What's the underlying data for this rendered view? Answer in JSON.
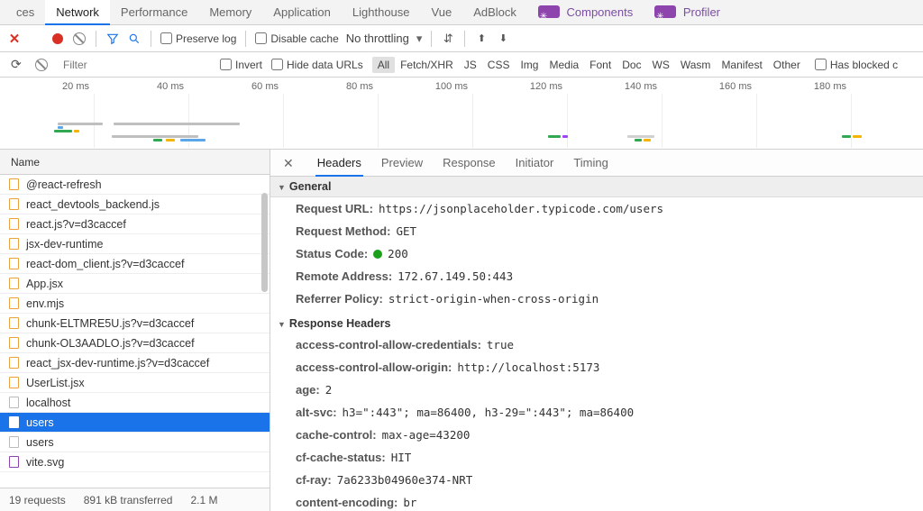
{
  "tabs": {
    "items": [
      "ces",
      "Network",
      "Performance",
      "Memory",
      "Application",
      "Lighthouse",
      "Vue",
      "AdBlock"
    ],
    "react": [
      "Components",
      "Profiler"
    ],
    "activeIndex": 1
  },
  "toolbar": {
    "preserve": "Preserve log",
    "disableCache": "Disable cache",
    "throttling": "No throttling"
  },
  "filterbar": {
    "placeholder": "Filter",
    "invert": "Invert",
    "hideDataUrls": "Hide data URLs",
    "types": [
      "All",
      "Fetch/XHR",
      "JS",
      "CSS",
      "Img",
      "Media",
      "Font",
      "Doc",
      "WS",
      "Wasm",
      "Manifest",
      "Other"
    ],
    "activeType": "All",
    "hasBlocked": "Has blocked c"
  },
  "timeline": {
    "ticks": [
      "20 ms",
      "40 ms",
      "60 ms",
      "80 ms",
      "100 ms",
      "120 ms",
      "140 ms",
      "160 ms",
      "180 ms"
    ],
    "bars": [
      {
        "t": 26,
        "l": 64,
        "w": 50,
        "c": "#bfbfbf"
      },
      {
        "t": 26,
        "l": 126,
        "w": 140,
        "c": "#bfbfbf"
      },
      {
        "t": 30,
        "l": 64,
        "w": 6,
        "c": "#5aa6e8"
      },
      {
        "t": 34,
        "l": 60,
        "w": 20,
        "c": "#33a852"
      },
      {
        "t": 34,
        "l": 82,
        "w": 6,
        "c": "#f4b400"
      },
      {
        "t": 40,
        "l": 124,
        "w": 96,
        "c": "#bfbfbf"
      },
      {
        "t": 44,
        "l": 170,
        "w": 10,
        "c": "#33a852"
      },
      {
        "t": 44,
        "l": 184,
        "w": 10,
        "c": "#f4b400"
      },
      {
        "t": 44,
        "l": 200,
        "w": 28,
        "c": "#5aa6e8"
      },
      {
        "t": 40,
        "l": 608,
        "w": 14,
        "c": "#33a852"
      },
      {
        "t": 40,
        "l": 624,
        "w": 6,
        "c": "#a142f4"
      },
      {
        "t": 40,
        "l": 696,
        "w": 30,
        "c": "#d0d0d0"
      },
      {
        "t": 44,
        "l": 704,
        "w": 8,
        "c": "#33a852"
      },
      {
        "t": 44,
        "l": 714,
        "w": 8,
        "c": "#f4b400"
      },
      {
        "t": 40,
        "l": 934,
        "w": 10,
        "c": "#33a852"
      },
      {
        "t": 40,
        "l": 946,
        "w": 10,
        "c": "#f4b400"
      }
    ]
  },
  "left": {
    "header": "Name",
    "rows": [
      {
        "name": "@react-refresh",
        "t": "js"
      },
      {
        "name": "react_devtools_backend.js",
        "t": "js"
      },
      {
        "name": "react.js?v=d3caccef",
        "t": "js"
      },
      {
        "name": "jsx-dev-runtime",
        "t": "js"
      },
      {
        "name": "react-dom_client.js?v=d3caccef",
        "t": "js"
      },
      {
        "name": "App.jsx",
        "t": "js"
      },
      {
        "name": "env.mjs",
        "t": "js"
      },
      {
        "name": "chunk-ELTMRE5U.js?v=d3caccef",
        "t": "js"
      },
      {
        "name": "chunk-OL3AADLO.js?v=d3caccef",
        "t": "js"
      },
      {
        "name": "react_jsx-dev-runtime.js?v=d3caccef",
        "t": "js"
      },
      {
        "name": "UserList.jsx",
        "t": "js"
      },
      {
        "name": "localhost",
        "t": "blank"
      },
      {
        "name": "users",
        "t": "blank",
        "selected": true
      },
      {
        "name": "users",
        "t": "blank"
      },
      {
        "name": "vite.svg",
        "t": "img"
      }
    ],
    "status": [
      "19 requests",
      "891 kB transferred",
      "2.1 M"
    ]
  },
  "details": {
    "tabs": [
      "Headers",
      "Preview",
      "Response",
      "Initiator",
      "Timing"
    ],
    "activeTab": 0,
    "general_label": "General",
    "general": [
      {
        "k": "Request URL:",
        "v": "https://jsonplaceholder.typicode.com/users",
        "mono": true
      },
      {
        "k": "Request Method:",
        "v": "GET",
        "mono": true
      },
      {
        "k": "Status Code:",
        "v": "200",
        "mono": true,
        "dot": true
      },
      {
        "k": "Remote Address:",
        "v": "172.67.149.50:443",
        "mono": true
      },
      {
        "k": "Referrer Policy:",
        "v": "strict-origin-when-cross-origin",
        "mono": true
      }
    ],
    "response_label": "Response Headers",
    "response": [
      {
        "k": "access-control-allow-credentials:",
        "v": "true"
      },
      {
        "k": "access-control-allow-origin:",
        "v": "http://localhost:5173"
      },
      {
        "k": "age:",
        "v": "2"
      },
      {
        "k": "alt-svc:",
        "v": "h3=\":443\"; ma=86400, h3-29=\":443\"; ma=86400"
      },
      {
        "k": "cache-control:",
        "v": "max-age=43200"
      },
      {
        "k": "cf-cache-status:",
        "v": "HIT"
      },
      {
        "k": "cf-ray:",
        "v": "7a6233b04960e374-NRT"
      },
      {
        "k": "content-encoding:",
        "v": "br"
      }
    ]
  }
}
